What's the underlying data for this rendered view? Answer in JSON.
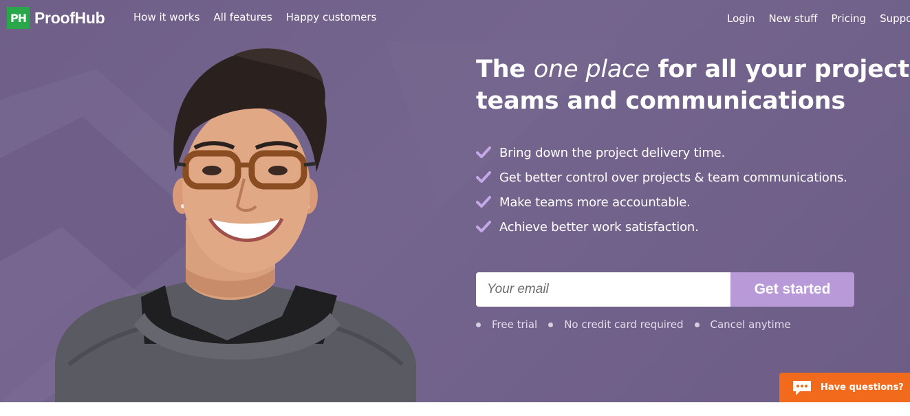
{
  "brand": {
    "logo_mark": "PH",
    "name": "ProofHub",
    "color": "#2aa74a"
  },
  "nav": {
    "left": [
      "How it works",
      "All features",
      "Happy customers"
    ],
    "right": [
      "Login",
      "New stuff",
      "Pricing",
      "Support"
    ]
  },
  "hero": {
    "background": "#74658e",
    "headline_part1": "The ",
    "headline_em": "one place",
    "headline_part2": " for all your projects,",
    "headline_line2": "teams and communications",
    "benefits": [
      "Bring down the project delivery time.",
      "Get better control over projects & team communications.",
      "Make teams more accountable.",
      "Achieve better work satisfaction."
    ],
    "check_icon": "check-icon",
    "check_color": "#c5a9e6"
  },
  "signup": {
    "email_placeholder": "Your email",
    "email_value": "",
    "cta_label": "Get started",
    "cta_color": "#b99ad9",
    "perks": [
      "Free trial",
      "No credit card required",
      "Cancel anytime"
    ]
  },
  "chat": {
    "label": "Have questions?",
    "icon": "chat-bubble-icon",
    "color": "#f26b1d"
  }
}
